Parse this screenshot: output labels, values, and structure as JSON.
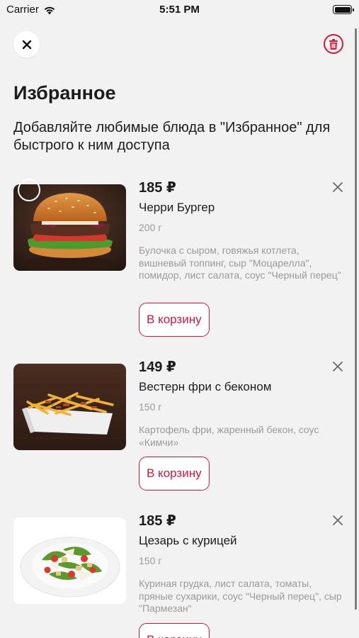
{
  "status_bar": {
    "carrier": "Carrier",
    "time": "5:51 PM"
  },
  "header": {
    "close_icon": "close-icon",
    "trash_icon": "trash-icon"
  },
  "page": {
    "title": "Избранное",
    "subtitle": "Добавляйте любимые блюда в \"Избранное\" для быстрого к ним доступа"
  },
  "items": [
    {
      "price": "185 ₽",
      "name": "Черри Бургер",
      "weight": "200 г",
      "description": "Булочка с сыром, говяжья котлета, вишневый топпинг, сыр \"Моцарелла\", помидор, лист салата, соус \"Черный перец\"",
      "cart_label": "В корзину",
      "image_icon": "burger-photo"
    },
    {
      "price": "149 ₽",
      "name": "Вестерн фри с беконом",
      "weight": "150 г",
      "description": "Картофель фри, жаренный бекон, соус «Кимчи»",
      "cart_label": "В корзину",
      "image_icon": "fries-photo"
    },
    {
      "price": "185 ₽",
      "name": "Цезарь с курицей",
      "weight": "150 г",
      "description": "Куриная грудка, лист салата, томаты, пряные сухарики, соус \"Черный перец\", сыр \"Пармезан\"",
      "cart_label": "В корзину",
      "image_icon": "salad-photo"
    }
  ],
  "colors": {
    "accent": "#d5173a",
    "background": "#f2f2f2",
    "muted_text": "#9a9a9a"
  }
}
